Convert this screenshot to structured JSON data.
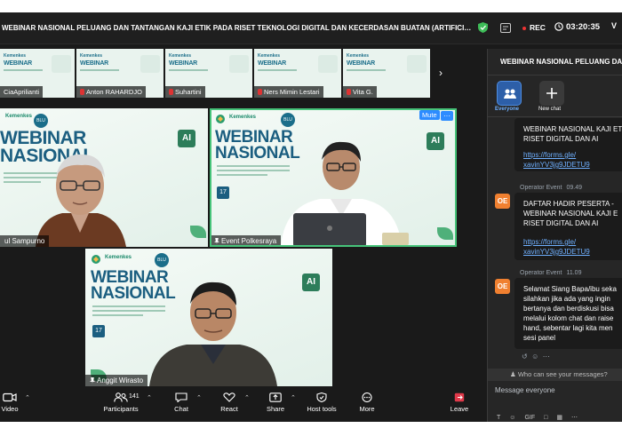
{
  "meeting": {
    "title": "WEBINAR NASIONAL PELUANG DAN TANTANGAN KAJI ETIK PADA RISET TEKNOLOGI DIGITAL DAN KECERDASAN BUATAN (ARTIFICIAL INTEL...",
    "rec_label": "REC",
    "timer": "03:20:35",
    "view_label": "V"
  },
  "thumbnails": [
    {
      "name": "CiaAprilianti",
      "muted": false
    },
    {
      "name": "Anton RAHARDJO",
      "muted": true
    },
    {
      "name": "Suhartini",
      "muted": true
    },
    {
      "name": "Ners Mimin Lestari",
      "muted": true
    },
    {
      "name": "Vita G.",
      "muted": true
    }
  ],
  "slide": {
    "kemenkes": "Kemenkes",
    "kemenkes_sub": "Poltekkes Palangka Raya",
    "blu": "BLU",
    "headline_1": "WEBINAR",
    "headline_2": "NASIONAL",
    "ai": "AI",
    "date": "17"
  },
  "videos": [
    {
      "name": "ul Sampurno"
    },
    {
      "name": "Event Polkesraya",
      "mute_label": "Mute",
      "more_label": "···"
    },
    {
      "name": "Anggit Wirasto"
    }
  ],
  "toolbar": {
    "video": "Video",
    "participants": "Participants",
    "participants_count": "141",
    "chat": "Chat",
    "react": "React",
    "share": "Share",
    "host_tools": "Host tools",
    "more": "More",
    "leave": "Leave"
  },
  "chat": {
    "header": "WEBINAR NASIONAL PELUANG DAN",
    "tabs": {
      "everyone": "Everyone",
      "new_chat": "New chat"
    },
    "msg1": {
      "line1": "WEBINAR NASIONAL KAJI ET",
      "line2": "RISET DIGITAL DAN AI",
      "link1": "https://forms.gle/",
      "link2": "xavinYV3jg9JDETU9"
    },
    "msg2": {
      "avatar": "OE",
      "sender": "Operator Event",
      "time": "09.49",
      "line1": "DAFTAR HADIR PESERTA -",
      "line2": "WEBINAR NASIONAL KAJI E",
      "line3": "RISET DIGITAL DAN AI",
      "link1": "https://forms.gle/",
      "link2": "xavinYV3jg9JDETU9"
    },
    "msg3": {
      "avatar": "OE",
      "sender": "Operator Event",
      "time": "11.09",
      "line1": "Selamat Siang Bapa/ibu seka",
      "line2": "silahkan jika ada yang ingin",
      "line3": "bertanya dan berdiskusi bisa",
      "line4": "melalui kolom chat dan raise",
      "line5": "hand, sebentar lagi kita men",
      "line6": "sesi panel"
    },
    "who_can_see": "Who can see your messages?",
    "input_placeholder": "Message everyone",
    "tools": {
      "t": "T",
      "gif": "GIF"
    }
  }
}
